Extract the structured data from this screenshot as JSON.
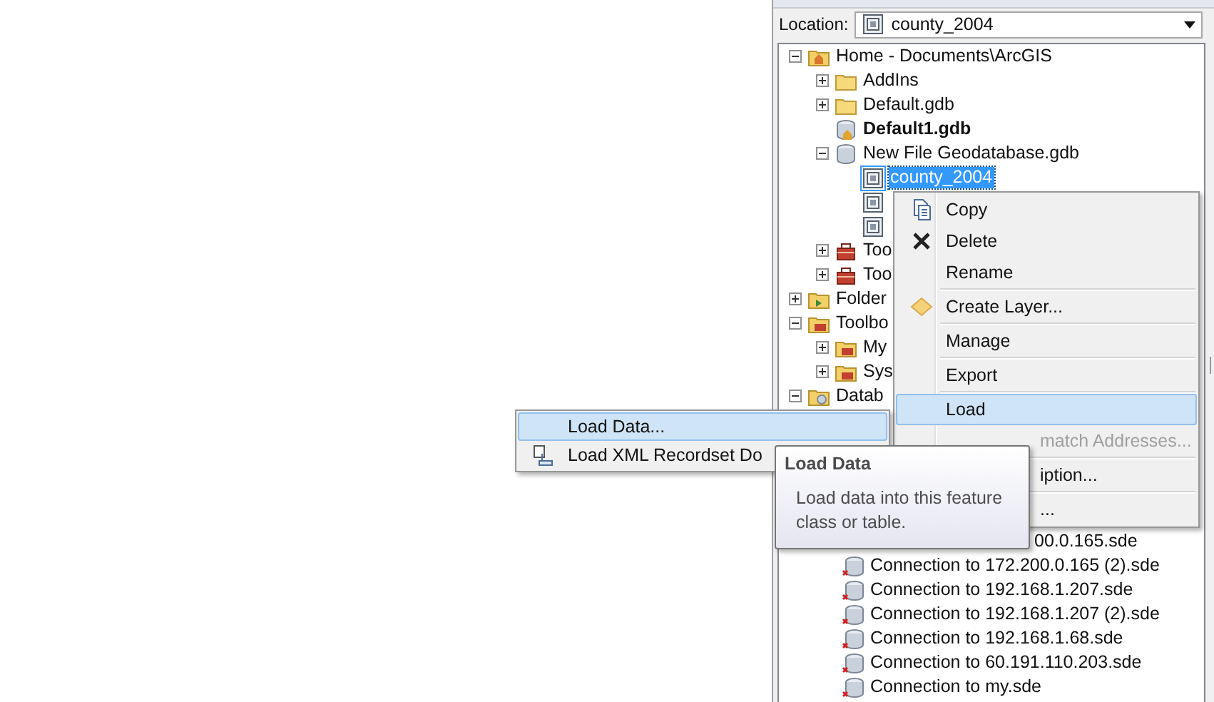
{
  "location": {
    "label": "Location:",
    "value": "county_2004"
  },
  "tree": [
    {
      "label": "Home - Documents\\ArcGIS",
      "kind": "home-folder",
      "expanded": true,
      "selected": false,
      "bold": false,
      "children": [
        {
          "label": "AddIns",
          "kind": "folder",
          "expanded": false,
          "selected": false,
          "bold": false
        },
        {
          "label": "Default.gdb",
          "kind": "folder",
          "expanded": false,
          "selected": false,
          "bold": false
        },
        {
          "label": "Default1.gdb",
          "kind": "home-database",
          "selected": false,
          "bold": true
        },
        {
          "label": "New File Geodatabase.gdb",
          "kind": "database",
          "expanded": true,
          "selected": false,
          "bold": false,
          "children": [
            {
              "label": "county_2004",
              "kind": "feature-class",
              "selected": true,
              "bold": false
            },
            {
              "kind": "feature-class",
              "selected": false
            },
            {
              "kind": "feature-class",
              "selected": false
            }
          ]
        },
        {
          "label": "Too",
          "kind": "toolbox",
          "expanded": false,
          "selected": false,
          "bold": false
        },
        {
          "label": "Too",
          "kind": "toolbox",
          "expanded": false,
          "selected": false,
          "bold": false
        }
      ]
    },
    {
      "label": "Folder",
      "kind": "folder-connection",
      "expanded": false,
      "selected": false,
      "bold": false
    },
    {
      "label": "Toolbo",
      "kind": "toolbox-folder",
      "expanded": true,
      "selected": false,
      "bold": false,
      "children": [
        {
          "label": "My",
          "kind": "toolbox-folder",
          "expanded": false,
          "selected": false,
          "bold": false
        },
        {
          "label": "Sys",
          "kind": "toolbox-folder",
          "expanded": false,
          "selected": false,
          "bold": false
        }
      ]
    },
    {
      "label": "Datab",
      "kind": "database-folder",
      "expanded": true,
      "selected": false,
      "bold": false
    }
  ],
  "lower_tree": [
    {
      "label": "00.0.165.sde",
      "kind": "partial"
    },
    {
      "label": "Connection to 172.200.0.165 (2).sde",
      "kind": "connection"
    },
    {
      "label": "Connection to 192.168.1.207.sde",
      "kind": "connection"
    },
    {
      "label": "Connection to 192.168.1.207 (2).sde",
      "kind": "connection"
    },
    {
      "label": "Connection to 192.168.1.68.sde",
      "kind": "connection"
    },
    {
      "label": "Connection to 60.191.110.203.sde",
      "kind": "connection"
    },
    {
      "label": "Connection to my.sde",
      "kind": "connection"
    }
  ],
  "context_menu": [
    {
      "label": "Copy",
      "kind": "copy",
      "selected": false,
      "disabled": false,
      "separator_after": false
    },
    {
      "label": "Delete",
      "kind": "delete",
      "selected": false,
      "disabled": false,
      "separator_after": false
    },
    {
      "label": "Rename",
      "kind": "plain",
      "selected": false,
      "disabled": false,
      "separator_after": true
    },
    {
      "label": "Create Layer...",
      "kind": "layer",
      "selected": false,
      "disabled": false,
      "separator_after": true
    },
    {
      "label": "Manage",
      "kind": "plain",
      "selected": false,
      "disabled": false,
      "separator_after": true
    },
    {
      "label": "Export",
      "kind": "plain",
      "selected": false,
      "disabled": false,
      "separator_after": true
    },
    {
      "label": "Load",
      "kind": "plain",
      "selected": true,
      "disabled": false,
      "separator_after": false
    },
    {
      "label": "match Addresses...",
      "kind": "partial",
      "selected": false,
      "disabled": true,
      "separator_after": true
    },
    {
      "label": "iption...",
      "kind": "partial",
      "selected": false,
      "disabled": false,
      "separator_after": true
    },
    {
      "label": "...",
      "kind": "partial",
      "selected": false,
      "disabled": false,
      "separator_after": false
    }
  ],
  "submenu": [
    {
      "label": "Load Data...",
      "kind": "plain",
      "selected": true
    },
    {
      "label": "Load XML Recordset Do",
      "kind": "xml",
      "selected": false
    }
  ],
  "tooltip": {
    "title": "Load Data",
    "text": "Load data into this feature class or table."
  }
}
